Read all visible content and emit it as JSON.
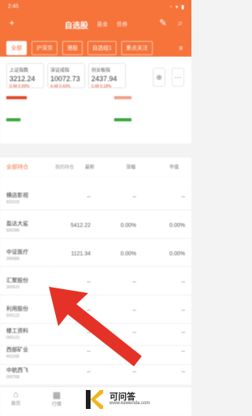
{
  "status_bar": {
    "time": "2:45",
    "right": "◔ ▾ ▮"
  },
  "header": {
    "title": "自选股",
    "tabs": [
      "基金",
      "债券"
    ],
    "left_icon": "add-icon",
    "right_icons": [
      "edit-icon",
      "search-icon"
    ]
  },
  "group_tabs": [
    "全部",
    "沪深京",
    "港股",
    "自选组1",
    "重点关注"
  ],
  "indices": [
    {
      "name": "上证指数",
      "value": "3212.24",
      "change": "0.48  0.99%"
    },
    {
      "name": "深证成指",
      "value": "10072.73",
      "change": "4.48  0.43%"
    },
    {
      "name": "创业板指",
      "value": "2437.94",
      "change": "0.48  0.18%"
    }
  ],
  "list_header": {
    "tab": "全部持仓",
    "filter": "我的持仓",
    "col_price": "最新",
    "col_change": "涨幅",
    "col_cap": "市值"
  },
  "rows": [
    {
      "name": "横店影视",
      "code": "603103",
      "price": "--",
      "pct": "--",
      "cap": "--"
    },
    {
      "name": "盈达大鲨",
      "code": "600396",
      "price": "5412.22",
      "pct": "0.00%",
      "cap": "0.00%"
    },
    {
      "name": "中证医疗",
      "code": "399989",
      "price": "1121.34",
      "pct": "0.00%",
      "cap": "0.00%"
    },
    {
      "name": "汇聚股份",
      "code": "300520",
      "price": "--",
      "pct": "--",
      "cap": "--"
    },
    {
      "name": "利用股份",
      "code": "600123",
      "price": "--",
      "pct": "--",
      "cap": "--"
    },
    {
      "name": "楼工资料",
      "code": "000123",
      "price": "--",
      "pct": "--",
      "cap": "--"
    },
    {
      "name": "西部矿业",
      "code": "601168",
      "price": "--",
      "pct": "--",
      "cap": "--"
    },
    {
      "name": "中航西飞",
      "code": "000768",
      "price": "--",
      "pct": "--",
      "cap": "--"
    }
  ],
  "bottom_nav": [
    "首页",
    "行情"
  ],
  "watermark": {
    "title": "可问答",
    "url": "www.kewenda.com"
  },
  "colors": {
    "accent": "#f6733a",
    "arrow": "#e53227",
    "up": "#e24a2b",
    "down": "#3aa83a"
  }
}
